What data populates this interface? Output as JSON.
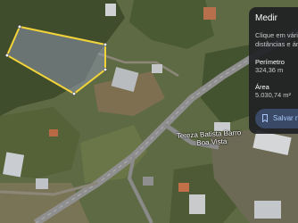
{
  "map": {
    "road_label": "Tereza Batista Barro",
    "road_label_2": "Boa Vista",
    "colors": {
      "polygon_outline": "#f2d43a",
      "road": "#9a9a9a",
      "panel_background": "#202124",
      "save_button_text": "#a8c7fa"
    }
  },
  "measure_panel": {
    "title": "Medir",
    "hint_line_1": "Clique em vários",
    "hint_line_2": "distâncias e áre",
    "perimeter_label": "Perímetro",
    "perimeter_value": "324,36 m",
    "area_label": "Área",
    "area_value": "5.030,74 m²",
    "save_button_label": "Salvar no",
    "save_icon": "bookmark-icon"
  }
}
